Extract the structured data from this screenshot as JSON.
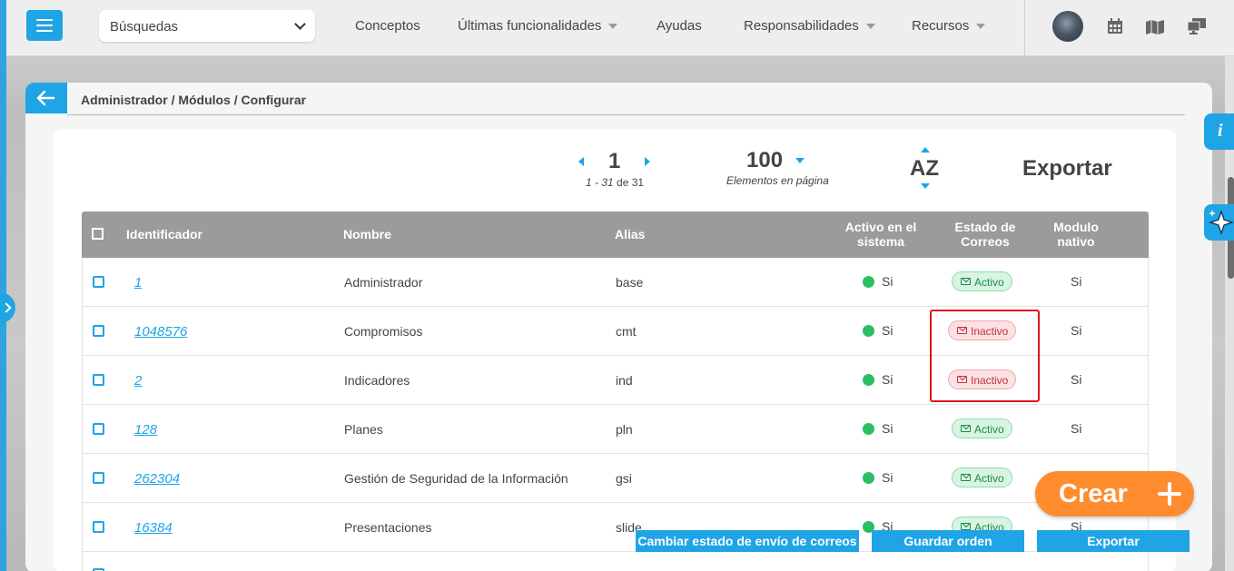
{
  "topbar": {
    "search_label": "Búsquedas",
    "nav": [
      "Conceptos",
      "Últimas funcionalidades",
      "Ayudas",
      "Responsabilidades",
      "Recursos"
    ]
  },
  "breadcrumb": "Administrador / Módulos / Configurar",
  "pagination": {
    "page": "1",
    "range_prefix": "1 - 31",
    "range_de": "de",
    "total": "31",
    "per_page": "100",
    "per_page_label": "Elementos en página",
    "sort_label": "AZ",
    "export_label": "Exportar"
  },
  "table": {
    "headers": {
      "id": "Identificador",
      "name": "Nombre",
      "alias": "Alias",
      "active_l1": "Activo en el",
      "active_l2": "sistema",
      "mail_l1": "Estado de",
      "mail_l2": "Correos",
      "native_l1": "Modulo",
      "native_l2": "nativo"
    },
    "rows": [
      {
        "id": "1",
        "name": "Administrador",
        "alias": "base",
        "active": "Si",
        "mail": "Activo",
        "native": "Si"
      },
      {
        "id": "1048576",
        "name": "Compromisos",
        "alias": "cmt",
        "active": "Si",
        "mail": "Inactivo",
        "native": "Si"
      },
      {
        "id": "2",
        "name": "Indicadores",
        "alias": "ind",
        "active": "Si",
        "mail": "Inactivo",
        "native": "Si"
      },
      {
        "id": "128",
        "name": "Planes",
        "alias": "pln",
        "active": "Si",
        "mail": "Activo",
        "native": "Si"
      },
      {
        "id": "262304",
        "name": "Gestión de Seguridad de la Información",
        "alias": "gsi",
        "active": "Si",
        "mail": "Activo",
        "native": ""
      },
      {
        "id": "16384",
        "name": "Presentaciones",
        "alias": "slide",
        "active": "Si",
        "mail": "Activo",
        "native": "Si"
      }
    ]
  },
  "actions": {
    "crear": "Crear",
    "change_mail": "Cambiar estado de envío de correos",
    "save_order": "Guardar orden",
    "export": "Exportar"
  },
  "side": {
    "info": "i"
  },
  "colors": {
    "accent": "#1fa4e6",
    "create": "#ff8c2e",
    "active_dot": "#2cbf62",
    "highlight": "#e2121b"
  }
}
